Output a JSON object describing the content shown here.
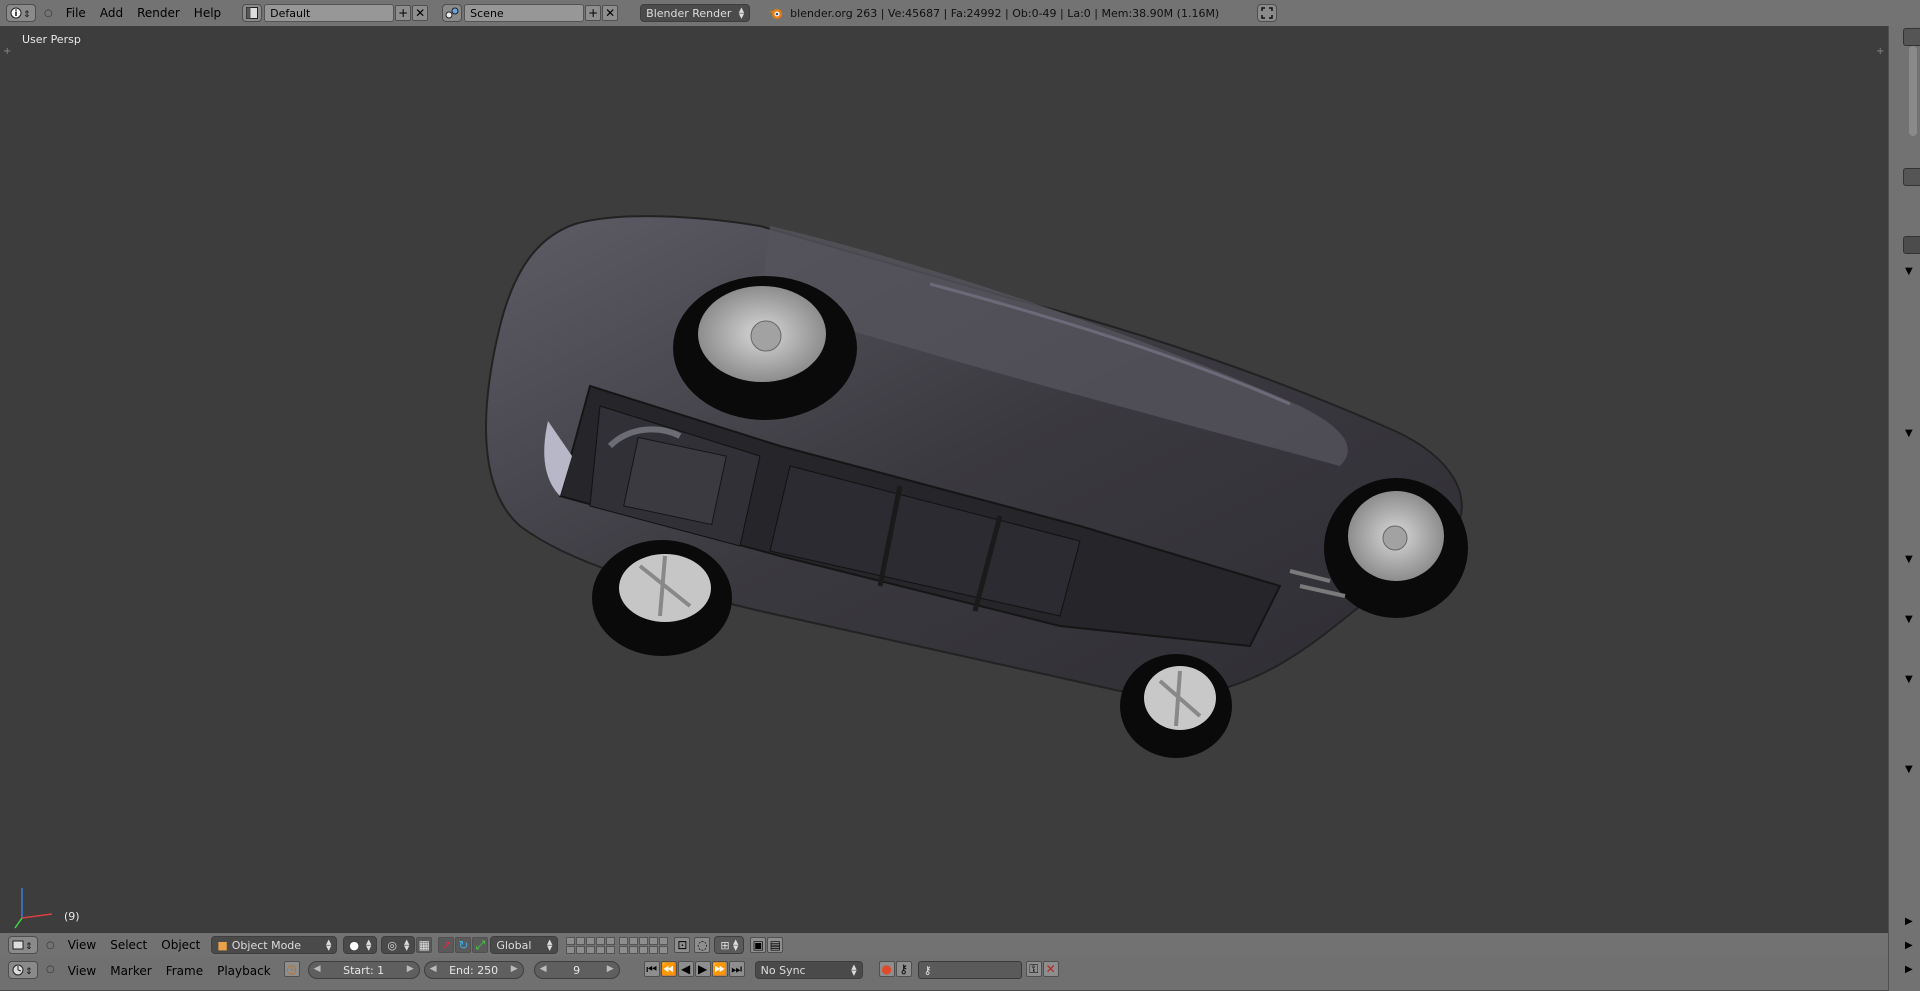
{
  "top": {
    "menus": [
      "File",
      "Add",
      "Render",
      "Help"
    ],
    "layout": "Default",
    "scene": "Scene",
    "engine": "Blender Render",
    "status": "blender.org 263 | Ve:45687 | Fa:24992 | Ob:0-49 | La:0 | Mem:38.90M (1.16M)"
  },
  "viewport": {
    "label": "User Persp",
    "frame_indicator": "(9)"
  },
  "header3d": {
    "menus": [
      "View",
      "Select",
      "Object"
    ],
    "mode": "Object Mode",
    "orientation": "Global"
  },
  "timeline": {
    "menus": [
      "View",
      "Marker",
      "Frame",
      "Playback"
    ],
    "start": "Start: 1",
    "end": "End: 250",
    "current": "9",
    "sync": "No Sync"
  },
  "icons": {
    "info": "info-icon",
    "layout": "screen-layout-icon",
    "scene": "scene-icon",
    "blender": "blender-logo-icon",
    "fullscreen": "fullscreen-icon",
    "view3d": "view3d-editor-icon",
    "timeline": "timeline-editor-icon"
  },
  "colors": {
    "viewport_bg": "#3d3d3d",
    "header_bg": "#727272",
    "record": "#e04a2a"
  }
}
